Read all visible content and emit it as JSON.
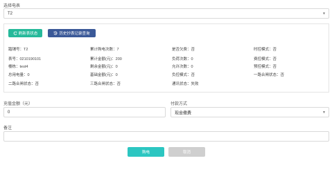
{
  "meter_select": {
    "label": "选择电表",
    "value": "T2"
  },
  "actions": {
    "refresh_label": "刷新表状态",
    "history_label": "历史抄表记录查询"
  },
  "meter_info": [
    [
      "踏铺号：T2",
      "累计购电次数：7",
      "是否欠费：否",
      "时控模式：否"
    ],
    [
      "表号：0210190101",
      "累计金额(元)：200",
      "负荷次数：0",
      "费控模式：否"
    ],
    [
      "楼栋：test4",
      "剩余金额(元)：0",
      "允许次数：0",
      "预控模式：否"
    ],
    [
      "总用电量：0",
      "基础金额(元)：0",
      "负控模式：否",
      "一路合闸状态：否"
    ],
    [
      "二路合闸状态：否",
      "三路合闸状态：否",
      "通讯状态：失败",
      ""
    ]
  ],
  "recharge": {
    "amount_label": "充值金额（元）",
    "amount_value": "0",
    "pay_label": "付款方式",
    "pay_value": "现金缴费"
  },
  "remark": {
    "label": "备注",
    "value": ""
  },
  "footer": {
    "submit_label": "购电",
    "cancel_label": "取消"
  }
}
